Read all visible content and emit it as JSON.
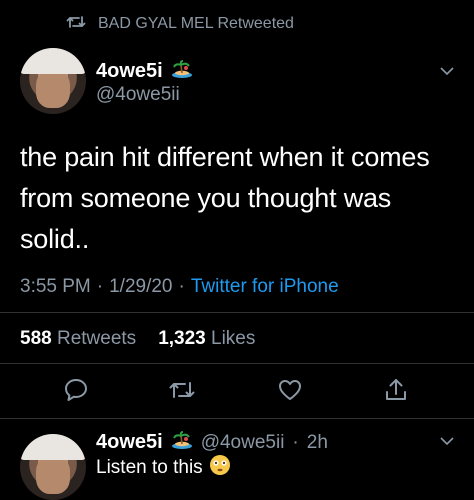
{
  "retweet_banner": {
    "text": "BAD GYAL MEL Retweeted",
    "icon": "retweet-icon"
  },
  "tweet": {
    "display_name": "4owe5i",
    "badge_icon": "island-emoji",
    "handle": "@4owe5ii",
    "text": "the pain hit different when it comes from someone you thought was solid..",
    "time": "3:55 PM",
    "date": "1/29/20",
    "source": "Twitter for iPhone",
    "separator": "·",
    "retweets_count": "588",
    "retweets_label": "Retweets",
    "likes_count": "1,323",
    "likes_label": "Likes"
  },
  "reply": {
    "display_name": "4owe5i",
    "badge_icon": "island-emoji",
    "handle": "@4owe5ii",
    "age": "2h",
    "separator": "·",
    "text": "Listen to this",
    "emoji_icon": "flushed-face-emoji"
  },
  "colors": {
    "background": "#000000",
    "muted": "#8b98a5",
    "link": "#1d9bf0",
    "divider": "#2f3336"
  }
}
